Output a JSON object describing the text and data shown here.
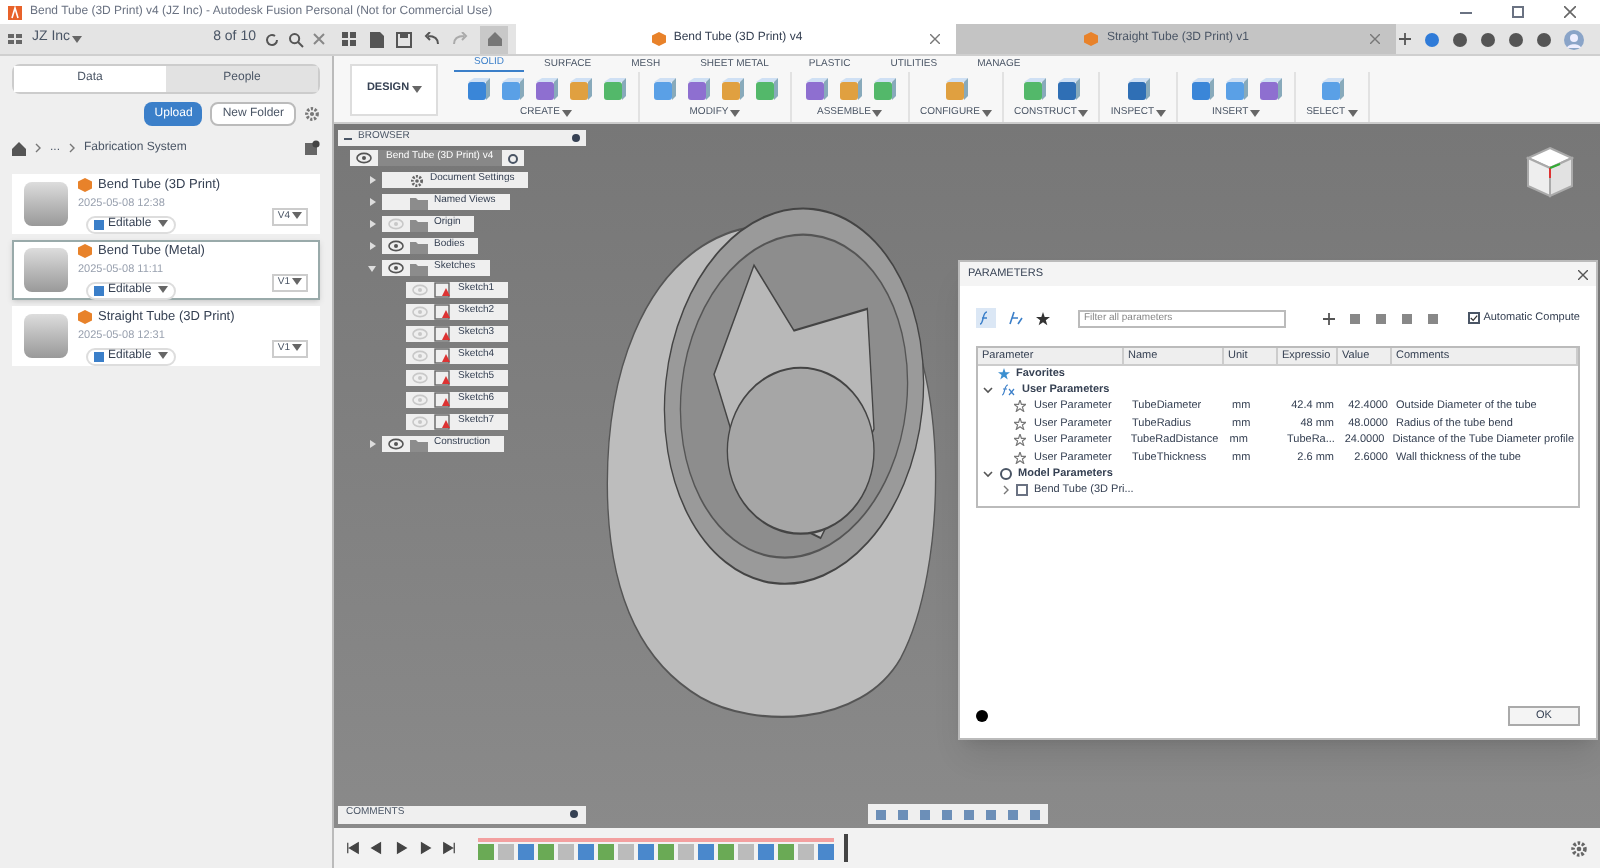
{
  "window": {
    "title": "Bend Tube (3D Print) v4 (JZ Inc) - Autodesk Fusion Personal (Not for Commercial Use)"
  },
  "app_bar": {
    "team": "JZ Inc",
    "job_count": "8 of 10"
  },
  "doc_tabs": [
    {
      "label": "Bend Tube (3D Print) v4",
      "selected": true
    },
    {
      "label": "Straight Tube (3D Print) v1",
      "selected": false
    }
  ],
  "data_panel": {
    "tabs": [
      {
        "label": "Data",
        "selected": true
      },
      {
        "label": "People",
        "selected": false
      }
    ],
    "upload": "Upload",
    "new_folder": "New Folder",
    "breadcrumb": [
      "...",
      "Fabrication System"
    ],
    "files": [
      {
        "name": "Bend Tube (3D Print)",
        "date": "2025-05-08 12:38",
        "status": "Editable",
        "version": "V4",
        "selected": false
      },
      {
        "name": "Bend Tube (Metal)",
        "date": "2025-05-08 11:11",
        "status": "Editable",
        "version": "V1",
        "selected": true
      },
      {
        "name": "Straight Tube (3D Print)",
        "date": "2025-05-08 12:31",
        "status": "Editable",
        "version": "V1",
        "selected": false
      }
    ]
  },
  "toolbar": {
    "workspace": "DESIGN",
    "tabs": [
      {
        "label": "SOLID",
        "selected": true
      },
      {
        "label": "SURFACE",
        "selected": false
      },
      {
        "label": "MESH",
        "selected": false
      },
      {
        "label": "SHEET METAL",
        "selected": false
      },
      {
        "label": "PLASTIC",
        "selected": false
      },
      {
        "label": "UTILITIES",
        "selected": false
      },
      {
        "label": "MANAGE",
        "selected": false
      }
    ],
    "groups": [
      {
        "label": "CREATE"
      },
      {
        "label": "MODIFY"
      },
      {
        "label": "ASSEMBLE"
      },
      {
        "label": "CONFIGURE"
      },
      {
        "label": "CONSTRUCT"
      },
      {
        "label": "INSPECT"
      },
      {
        "label": "INSERT"
      },
      {
        "label": "SELECT"
      }
    ]
  },
  "browser": {
    "title": "BROWSER",
    "root": "Bend Tube (3D Print) v4",
    "items": [
      {
        "kind": "settings",
        "label": "Document Settings",
        "expanded": false
      },
      {
        "kind": "folder",
        "label": "Named Views",
        "expanded": false
      },
      {
        "kind": "folder",
        "label": "Origin",
        "expanded": false,
        "visible": false
      },
      {
        "kind": "folder",
        "label": "Bodies",
        "expanded": false,
        "visible": true
      },
      {
        "kind": "folder",
        "label": "Sketches",
        "expanded": true,
        "visible": true,
        "children": [
          {
            "kind": "sketch",
            "label": "Sketch1",
            "visible": false
          },
          {
            "kind": "sketch",
            "label": "Sketch2",
            "visible": false
          },
          {
            "kind": "sketch",
            "label": "Sketch3",
            "visible": false
          },
          {
            "kind": "sketch",
            "label": "Sketch4",
            "visible": false
          },
          {
            "kind": "sketch",
            "label": "Sketch5",
            "visible": false
          },
          {
            "kind": "sketch",
            "label": "Sketch6",
            "visible": false
          },
          {
            "kind": "sketch",
            "label": "Sketch7",
            "visible": false
          }
        ]
      },
      {
        "kind": "folder",
        "label": "Construction",
        "expanded": false,
        "visible": true
      }
    ]
  },
  "parameters": {
    "title": "PARAMETERS",
    "filter_placeholder": "Filter all parameters",
    "auto_compute": {
      "label": "Automatic Compute",
      "checked": true
    },
    "columns": [
      "Parameter",
      "Name",
      "Unit",
      "Expressio",
      "Value",
      "Comments"
    ],
    "favorites": "Favorites",
    "user_group": {
      "label": "User Parameters",
      "expanded": true
    },
    "rows": [
      {
        "parameter": "User Parameter",
        "name": "TubeDiameter",
        "unit": "mm",
        "expression": "42.4 mm",
        "value": "42.4000",
        "comment": "Outside Diameter of the tube"
      },
      {
        "parameter": "User Parameter",
        "name": "TubeRadius",
        "unit": "mm",
        "expression": "48 mm",
        "value": "48.0000",
        "comment": "Radius of the tube bend"
      },
      {
        "parameter": "User Parameter",
        "name": "TubeRadDistance",
        "unit": "mm",
        "expression": "TubeRa...",
        "value": "24.0000",
        "comment": "Distance of the Tube Diameter profile"
      },
      {
        "parameter": "User Parameter",
        "name": "TubeThickness",
        "unit": "mm",
        "expression": "2.6 mm",
        "value": "2.6000",
        "comment": "Wall thickness of the tube"
      }
    ],
    "model_group": {
      "label": "Model Parameters",
      "expanded": true,
      "children": [
        "Bend Tube (3D Pri..."
      ]
    },
    "ok": "OK"
  },
  "comments": {
    "title": "COMMENTS"
  }
}
